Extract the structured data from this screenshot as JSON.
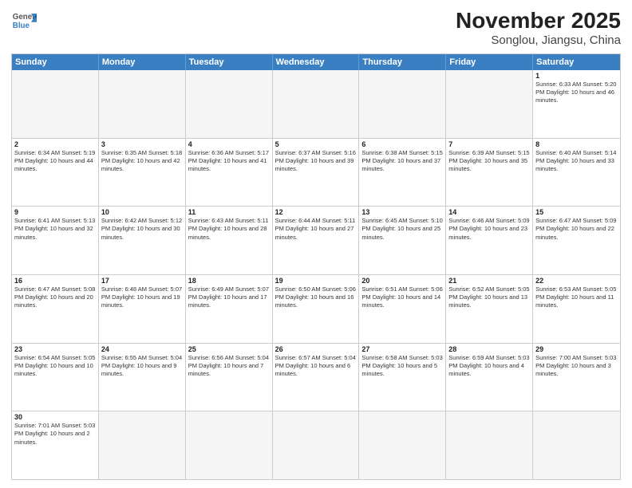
{
  "header": {
    "logo_general": "General",
    "logo_blue": "Blue",
    "title": "November 2025",
    "subtitle": "Songlou, Jiangsu, China"
  },
  "days_of_week": [
    "Sunday",
    "Monday",
    "Tuesday",
    "Wednesday",
    "Thursday",
    "Friday",
    "Saturday"
  ],
  "weeks": [
    [
      {
        "day": "",
        "info": "",
        "shaded": true
      },
      {
        "day": "",
        "info": "",
        "shaded": true
      },
      {
        "day": "",
        "info": "",
        "shaded": true
      },
      {
        "day": "",
        "info": "",
        "shaded": true
      },
      {
        "day": "",
        "info": "",
        "shaded": true
      },
      {
        "day": "",
        "info": "",
        "shaded": true
      },
      {
        "day": "1",
        "info": "Sunrise: 6:33 AM\nSunset: 5:20 PM\nDaylight: 10 hours and 46 minutes.",
        "shaded": false
      }
    ],
    [
      {
        "day": "2",
        "info": "Sunrise: 6:34 AM\nSunset: 5:19 PM\nDaylight: 10 hours and 44 minutes.",
        "shaded": false
      },
      {
        "day": "3",
        "info": "Sunrise: 6:35 AM\nSunset: 5:18 PM\nDaylight: 10 hours and 42 minutes.",
        "shaded": false
      },
      {
        "day": "4",
        "info": "Sunrise: 6:36 AM\nSunset: 5:17 PM\nDaylight: 10 hours and 41 minutes.",
        "shaded": false
      },
      {
        "day": "5",
        "info": "Sunrise: 6:37 AM\nSunset: 5:16 PM\nDaylight: 10 hours and 39 minutes.",
        "shaded": false
      },
      {
        "day": "6",
        "info": "Sunrise: 6:38 AM\nSunset: 5:15 PM\nDaylight: 10 hours and 37 minutes.",
        "shaded": false
      },
      {
        "day": "7",
        "info": "Sunrise: 6:39 AM\nSunset: 5:15 PM\nDaylight: 10 hours and 35 minutes.",
        "shaded": false
      },
      {
        "day": "8",
        "info": "Sunrise: 6:40 AM\nSunset: 5:14 PM\nDaylight: 10 hours and 33 minutes.",
        "shaded": false
      }
    ],
    [
      {
        "day": "9",
        "info": "Sunrise: 6:41 AM\nSunset: 5:13 PM\nDaylight: 10 hours and 32 minutes.",
        "shaded": false
      },
      {
        "day": "10",
        "info": "Sunrise: 6:42 AM\nSunset: 5:12 PM\nDaylight: 10 hours and 30 minutes.",
        "shaded": false
      },
      {
        "day": "11",
        "info": "Sunrise: 6:43 AM\nSunset: 5:11 PM\nDaylight: 10 hours and 28 minutes.",
        "shaded": false
      },
      {
        "day": "12",
        "info": "Sunrise: 6:44 AM\nSunset: 5:11 PM\nDaylight: 10 hours and 27 minutes.",
        "shaded": false
      },
      {
        "day": "13",
        "info": "Sunrise: 6:45 AM\nSunset: 5:10 PM\nDaylight: 10 hours and 25 minutes.",
        "shaded": false
      },
      {
        "day": "14",
        "info": "Sunrise: 6:46 AM\nSunset: 5:09 PM\nDaylight: 10 hours and 23 minutes.",
        "shaded": false
      },
      {
        "day": "15",
        "info": "Sunrise: 6:47 AM\nSunset: 5:09 PM\nDaylight: 10 hours and 22 minutes.",
        "shaded": false
      }
    ],
    [
      {
        "day": "16",
        "info": "Sunrise: 6:47 AM\nSunset: 5:08 PM\nDaylight: 10 hours and 20 minutes.",
        "shaded": false
      },
      {
        "day": "17",
        "info": "Sunrise: 6:48 AM\nSunset: 5:07 PM\nDaylight: 10 hours and 19 minutes.",
        "shaded": false
      },
      {
        "day": "18",
        "info": "Sunrise: 6:49 AM\nSunset: 5:07 PM\nDaylight: 10 hours and 17 minutes.",
        "shaded": false
      },
      {
        "day": "19",
        "info": "Sunrise: 6:50 AM\nSunset: 5:06 PM\nDaylight: 10 hours and 16 minutes.",
        "shaded": false
      },
      {
        "day": "20",
        "info": "Sunrise: 6:51 AM\nSunset: 5:06 PM\nDaylight: 10 hours and 14 minutes.",
        "shaded": false
      },
      {
        "day": "21",
        "info": "Sunrise: 6:52 AM\nSunset: 5:05 PM\nDaylight: 10 hours and 13 minutes.",
        "shaded": false
      },
      {
        "day": "22",
        "info": "Sunrise: 6:53 AM\nSunset: 5:05 PM\nDaylight: 10 hours and 11 minutes.",
        "shaded": false
      }
    ],
    [
      {
        "day": "23",
        "info": "Sunrise: 6:54 AM\nSunset: 5:05 PM\nDaylight: 10 hours and 10 minutes.",
        "shaded": false
      },
      {
        "day": "24",
        "info": "Sunrise: 6:55 AM\nSunset: 5:04 PM\nDaylight: 10 hours and 9 minutes.",
        "shaded": false
      },
      {
        "day": "25",
        "info": "Sunrise: 6:56 AM\nSunset: 5:04 PM\nDaylight: 10 hours and 7 minutes.",
        "shaded": false
      },
      {
        "day": "26",
        "info": "Sunrise: 6:57 AM\nSunset: 5:04 PM\nDaylight: 10 hours and 6 minutes.",
        "shaded": false
      },
      {
        "day": "27",
        "info": "Sunrise: 6:58 AM\nSunset: 5:03 PM\nDaylight: 10 hours and 5 minutes.",
        "shaded": false
      },
      {
        "day": "28",
        "info": "Sunrise: 6:59 AM\nSunset: 5:03 PM\nDaylight: 10 hours and 4 minutes.",
        "shaded": false
      },
      {
        "day": "29",
        "info": "Sunrise: 7:00 AM\nSunset: 5:03 PM\nDaylight: 10 hours and 3 minutes.",
        "shaded": false
      }
    ],
    [
      {
        "day": "30",
        "info": "Sunrise: 7:01 AM\nSunset: 5:03 PM\nDaylight: 10 hours and 2 minutes.",
        "shaded": false
      },
      {
        "day": "",
        "info": "",
        "shaded": true
      },
      {
        "day": "",
        "info": "",
        "shaded": true
      },
      {
        "day": "",
        "info": "",
        "shaded": true
      },
      {
        "day": "",
        "info": "",
        "shaded": true
      },
      {
        "day": "",
        "info": "",
        "shaded": true
      },
      {
        "day": "",
        "info": "",
        "shaded": true
      }
    ]
  ]
}
